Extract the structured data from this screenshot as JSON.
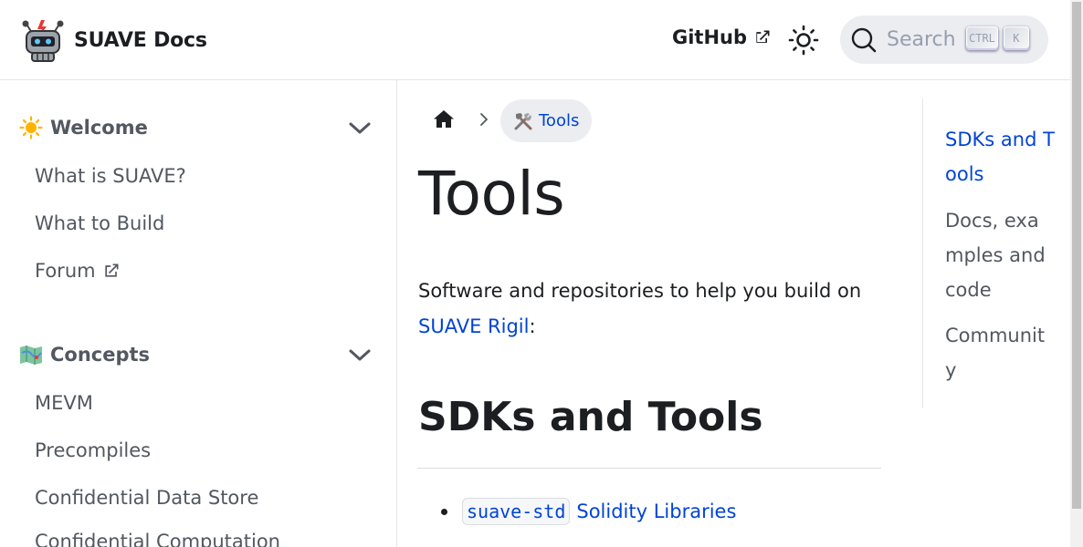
{
  "navbar": {
    "brand_title": "SUAVE Docs",
    "github_label": "GitHub",
    "search_label": "Search",
    "kbd_ctrl": "CTRL",
    "kbd_k": "K"
  },
  "sidebar": {
    "categories": [
      {
        "label": "Welcome",
        "emoji": "sun-emoji",
        "items": [
          {
            "label": "What is SUAVE?"
          },
          {
            "label": "What to Build"
          },
          {
            "label": "Forum",
            "external": true
          }
        ]
      },
      {
        "label": "Concepts",
        "emoji": "map-emoji",
        "items": [
          {
            "label": "MEVM"
          },
          {
            "label": "Precompiles"
          },
          {
            "label": "Confidential Data Store"
          },
          {
            "label": "Confidential Computation"
          }
        ]
      }
    ]
  },
  "breadcrumb": {
    "active_label": "Tools",
    "active_emoji": "tools-emoji"
  },
  "main": {
    "title": "Tools",
    "intro_text": "Software and repositories to help you build on ",
    "intro_link": "SUAVE Rigil",
    "intro_suffix": ":",
    "section_title": "SDKs and Tools",
    "list": [
      {
        "code": "suave-std",
        "link": "Solidity Libraries"
      }
    ]
  },
  "toc": {
    "items": [
      {
        "label": "SDKs and Tools",
        "active": true
      },
      {
        "label": "Docs, examples and code",
        "active": false
      },
      {
        "label": "Community",
        "active": false
      }
    ]
  },
  "colors": {
    "link": "#0044d6",
    "text": "#1c1e21",
    "muted": "#525860",
    "pill_bg": "#ebedf0"
  }
}
